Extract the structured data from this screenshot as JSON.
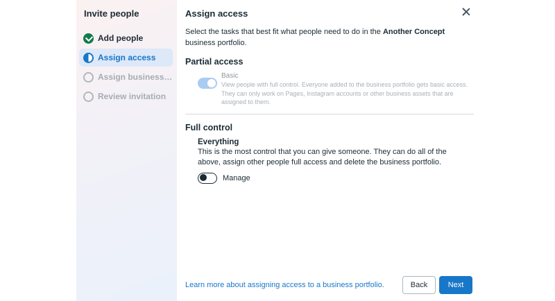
{
  "sidebar": {
    "title": "Invite people",
    "steps": [
      {
        "label": "Add people",
        "state": "done"
      },
      {
        "label": "Assign access",
        "state": "active"
      },
      {
        "label": "Assign business a...",
        "state": "pending"
      },
      {
        "label": "Review invitation",
        "state": "pending"
      }
    ]
  },
  "main": {
    "title": "Assign access",
    "intro_before": "Select the tasks that best fit what people need to do in the ",
    "intro_bold": "Another Concept",
    "intro_after": " business portfolio.",
    "partial": {
      "heading": "Partial access",
      "option_title": "Basic",
      "option_desc": "View people with full control. Everyone added to the business portfolio gets basic access. They can only work on Pages, Instagram accounts or other business assets that are assigned to them.",
      "toggle_on": true
    },
    "full": {
      "heading": "Full control",
      "option_title": "Everything",
      "option_desc": "This is the most control that you can give someone. They can do all of the above, assign other people full access and delete the business portfolio.",
      "toggle_label": "Manage",
      "toggle_on": false
    }
  },
  "footer": {
    "learn_link": "Learn more about assigning access to a business portfolio.",
    "back_label": "Back",
    "next_label": "Next"
  },
  "colors": {
    "accent": "#1877c9",
    "done": "#117b4c",
    "text": "#1c2b33"
  },
  "icons": {
    "close": "close-icon",
    "done_step": "check-circle-icon",
    "active_step": "half-circle-icon",
    "pending_step": "empty-circle-icon"
  }
}
